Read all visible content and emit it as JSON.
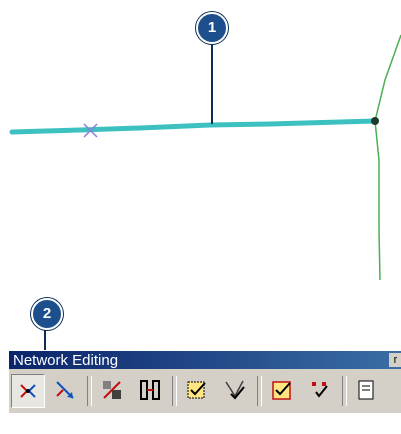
{
  "callouts": {
    "first": "1",
    "second": "2"
  },
  "toolbar": {
    "title": "Network Editing",
    "close_label": "r",
    "tools": [
      {
        "icon": "network-edit-tool-icon",
        "pressed": true
      },
      {
        "icon": "reverse-flow-icon",
        "pressed": false
      },
      {
        "icon": "connect-feature-icon",
        "pressed": false
      },
      {
        "icon": "disconnect-feature-icon",
        "pressed": false
      },
      {
        "icon": "validate-topology-icon",
        "pressed": false
      },
      {
        "icon": "validate-selection-icon",
        "pressed": false
      },
      {
        "icon": "error-inspector-icon",
        "pressed": false
      },
      {
        "icon": "mark-errors-icon",
        "pressed": false
      },
      {
        "icon": "properties-icon",
        "pressed": false
      }
    ]
  },
  "colors": {
    "main_line": "#3cc0c0",
    "branch_line": "#4caf50",
    "callout": "#1d4f8c",
    "toolbar_bg": "#d4d0c8",
    "titlebar": "#0a246a"
  }
}
